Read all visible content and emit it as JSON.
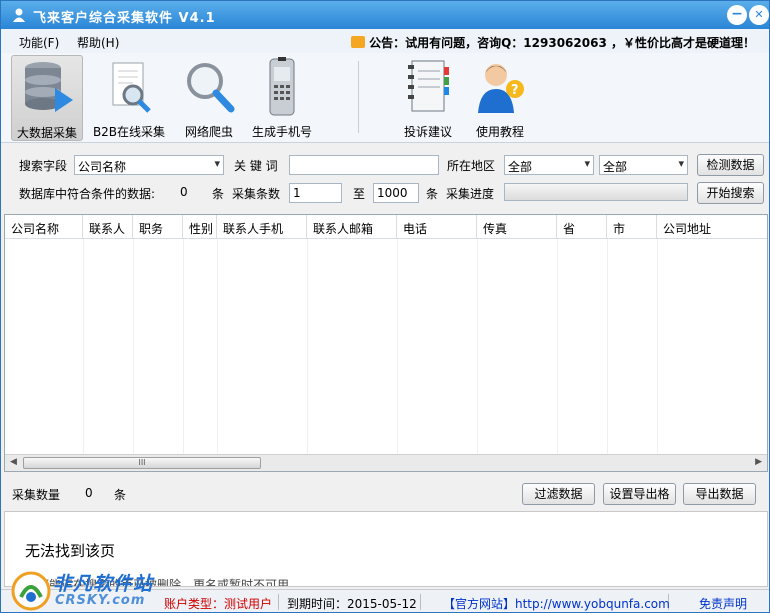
{
  "window": {
    "title": "飞来客户综合采集软件   V4.1",
    "minimize": "−",
    "close": "✕"
  },
  "menu": {
    "items": [
      "功能(F)",
      "帮助(H)"
    ],
    "notice": "公告：试用有问题，咨询Q：1293062063 ，￥性价比高才是硬道理！"
  },
  "toolbar": {
    "items": [
      {
        "label": "大数据采集",
        "icon": "database-icon",
        "active": true
      },
      {
        "label": "B2B在线采集",
        "icon": "document-search-icon"
      },
      {
        "label": "网络爬虫",
        "icon": "magnifier-icon"
      },
      {
        "label": "生成手机号",
        "icon": "mobile-phone-icon"
      },
      {
        "label": "投诉建议",
        "icon": "notebook-icon"
      },
      {
        "label": "使用教程",
        "icon": "help-user-icon"
      }
    ]
  },
  "form": {
    "search_field_label": "搜索字段",
    "search_field_value": "公司名称",
    "keyword_label": "关 键 词",
    "keyword_value": "",
    "region_label": "所在地区",
    "province_value": "全部",
    "city_value": "全部",
    "check_button": "检测数据",
    "match_label": "数据库中符合条件的数据:",
    "match_count": "0",
    "unit1": "条",
    "collect_count_label": "采集条数",
    "collect_from": "1",
    "to_label": "至",
    "collect_to": "1000",
    "unit2": "条",
    "progress_label": "采集进度",
    "progress": 0,
    "start_button": "开始搜索"
  },
  "table": {
    "columns": [
      "公司名称",
      "联系人",
      "职务",
      "性别",
      "联系人手机",
      "联系人邮箱",
      "电话",
      "传真",
      "省",
      "市",
      "公司地址"
    ],
    "rows": [],
    "scroll_thumb": "III"
  },
  "stats": {
    "label": "采集数量",
    "count": "0",
    "unit": "条",
    "filter_button": "过滤数据",
    "export_format_button": "设置导出格",
    "export_button": "导出数据"
  },
  "browser": {
    "title": "无法找到该页",
    "text": "您可能正在搜索的页已被删除、更名或暂时不可用。"
  },
  "status": {
    "account_type": "账户类型：测试用户",
    "expire": "到期时间：2015-05-12",
    "website": "【官方网站】http://www.yobqunfa.com",
    "disclaimer": "免责声明"
  },
  "watermark": {
    "text": "非凡软件站",
    "sub": "CRSKY.com"
  },
  "colors": {
    "titlebar": "#2a85d6",
    "account_red": "#d00000",
    "link_blue": "#0033cc"
  }
}
